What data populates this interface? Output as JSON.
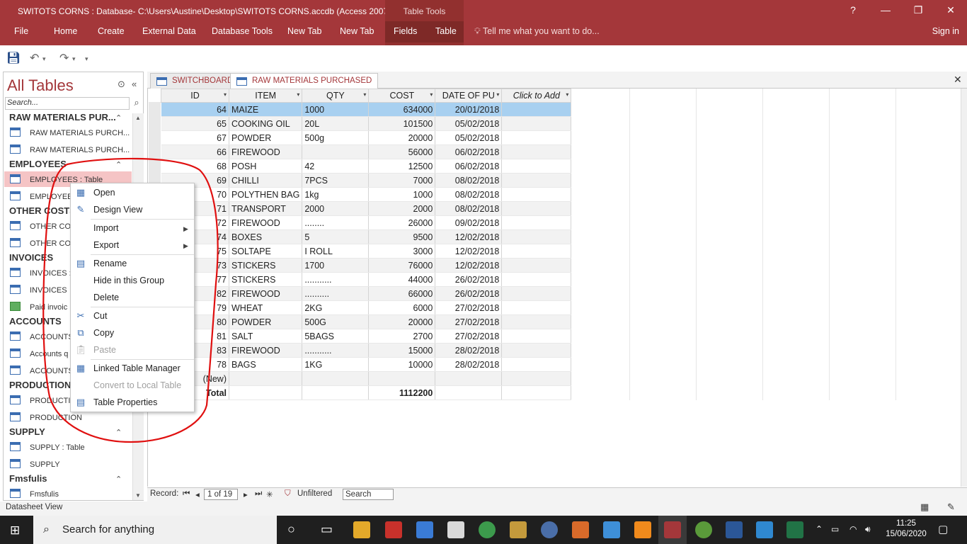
{
  "app": {
    "title": "SWITOTS CORNS : Database- C:\\Users\\Austine\\Desktop\\SWITOTS CORNS.accdb (Access 2007 -...",
    "context_tools_label": "Table Tools",
    "help_glyph": "?",
    "restore_glyph": "❐",
    "close_glyph": "✕",
    "min_glyph": "—"
  },
  "ribbon": {
    "tabs": [
      "File",
      "Home",
      "Create",
      "External Data",
      "Database Tools",
      "New Tab",
      "New Tab",
      "Fields",
      "Table"
    ],
    "tell_me": "Tell me what you want to do...",
    "sign_in": "Sign in"
  },
  "nav": {
    "header": "All Tables",
    "search_placeholder": "Search...",
    "groups": [
      {
        "name": "RAW MATERIALS PUR...",
        "items": [
          "RAW MATERIALS PURCH...",
          "RAW MATERIALS PURCH..."
        ]
      },
      {
        "name": "EMPLOYEES",
        "items": [
          "EMPLOYEES : Table",
          "EMPLOYEES"
        ]
      },
      {
        "name": "OTHER COSTS",
        "items": [
          "OTHER CO",
          "OTHER CO"
        ]
      },
      {
        "name": "INVOICES",
        "items": [
          "INVOICES :",
          "INVOICES",
          "Paid invoic"
        ]
      },
      {
        "name": "ACCOUNTS",
        "items": [
          "ACCOUNTS",
          "Accounts q",
          "ACCOUNTS"
        ]
      },
      {
        "name": "PRODUCTION",
        "items": [
          "PRODUCTIO",
          "PRODUCTION"
        ]
      },
      {
        "name": "SUPPLY",
        "items": [
          "SUPPLY : Table",
          "SUPPLY"
        ]
      },
      {
        "name": "Fmsfulis",
        "items": [
          "Fmsfulis"
        ]
      }
    ]
  },
  "doc_tabs": [
    "SWITCHBOARD",
    "RAW MATERIALS PURCHASED"
  ],
  "table": {
    "columns": [
      "ID",
      "ITEM",
      "QTY",
      "COST",
      "DATE OF PU",
      "Click to Add"
    ],
    "rows": [
      [
        "64",
        "MAIZE",
        "1000",
        "634000",
        "20/01/2018"
      ],
      [
        "65",
        "COOKING OIL",
        "20L",
        "101500",
        "05/02/2018"
      ],
      [
        "67",
        "POWDER",
        "500g",
        "20000",
        "05/02/2018"
      ],
      [
        "66",
        "FIREWOOD",
        "",
        "56000",
        "06/02/2018"
      ],
      [
        "68",
        "POSH",
        "42",
        "12500",
        "06/02/2018"
      ],
      [
        "69",
        "CHILLI",
        "7PCS",
        "7000",
        "08/02/2018"
      ],
      [
        "70",
        "POLYTHEN BAG",
        "1kg",
        "1000",
        "08/02/2018"
      ],
      [
        "71",
        "TRANSPORT",
        "2000",
        "2000",
        "08/02/2018"
      ],
      [
        "72",
        "FIREWOOD",
        "........",
        "26000",
        "09/02/2018"
      ],
      [
        "74",
        "BOXES",
        "5",
        "9500",
        "12/02/2018"
      ],
      [
        "75",
        "SOLTAPE",
        "I ROLL",
        "3000",
        "12/02/2018"
      ],
      [
        "73",
        "STICKERS",
        "1700",
        "76000",
        "12/02/2018"
      ],
      [
        "77",
        "STICKERS",
        "...........",
        "44000",
        "26/02/2018"
      ],
      [
        "82",
        "FIREWOOD",
        "..........",
        "66000",
        "26/02/2018"
      ],
      [
        "79",
        "WHEAT",
        "2KG",
        "6000",
        "27/02/2018"
      ],
      [
        "80",
        "POWDER",
        "500G",
        "20000",
        "27/02/2018"
      ],
      [
        "81",
        "SALT",
        "5BAGS",
        "2700",
        "27/02/2018"
      ],
      [
        "83",
        "FIREWOOD",
        "...........",
        "15000",
        "28/02/2018"
      ],
      [
        "78",
        "BAGS",
        "1KG",
        "10000",
        "28/02/2018"
      ]
    ],
    "new_row_label": "(New)",
    "total_label": "Total",
    "total_value": "1112200"
  },
  "context_menu": {
    "items": [
      "Open",
      "Design View",
      "Import",
      "Export",
      "Rename",
      "Hide in this Group",
      "Delete",
      "Cut",
      "Copy",
      "Paste",
      "Linked Table Manager",
      "Convert to Local Table",
      "Table Properties"
    ]
  },
  "record_bar": {
    "label": "Record:",
    "position": "1 of 19",
    "filter": "Unfiltered",
    "search": "Search"
  },
  "status": {
    "view": "Datasheet View"
  },
  "taskbar": {
    "search": "Search for anything",
    "time": "11:25",
    "date": "15/06/2020"
  },
  "colors": {
    "accent": "#a4373a",
    "selection": "#a8d0f0",
    "annotation": "#e01010"
  }
}
